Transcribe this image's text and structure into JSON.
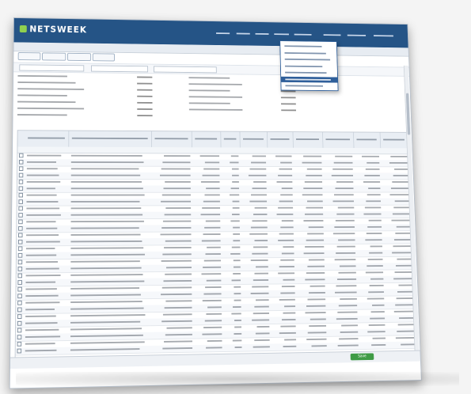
{
  "app": {
    "logo_text": "NETSWEEK",
    "brand_color": "#255486",
    "accent_color": "#3f9b45"
  },
  "nav": {
    "items": [
      {
        "label": ""
      },
      {
        "label": ""
      },
      {
        "label": ""
      },
      {
        "label": ""
      },
      {
        "label": ""
      },
      {
        "label": ""
      },
      {
        "label": ""
      },
      {
        "label": ""
      }
    ]
  },
  "dropdown": {
    "items": [
      {
        "label": ""
      },
      {
        "label": ""
      },
      {
        "label": ""
      },
      {
        "label": ""
      },
      {
        "label": ""
      },
      {
        "label": ""
      },
      {
        "label": ""
      }
    ],
    "highlighted_index": 5
  },
  "subnav": {
    "text": ""
  },
  "toolbar": {
    "buttons": [
      {
        "label": ""
      },
      {
        "label": ""
      },
      {
        "label": ""
      },
      {
        "label": ""
      }
    ]
  },
  "filterbar": {
    "fields": [
      {
        "value": ""
      },
      {
        "value": ""
      },
      {
        "value": ""
      }
    ]
  },
  "summary": {
    "left": [
      {
        "label": "",
        "value": ""
      },
      {
        "label": "",
        "value": ""
      },
      {
        "label": "",
        "value": ""
      },
      {
        "label": "",
        "value": ""
      },
      {
        "label": "",
        "value": ""
      },
      {
        "label": "",
        "value": ""
      },
      {
        "label": "",
        "value": ""
      }
    ],
    "right": [
      {
        "label": "",
        "value": ""
      },
      {
        "label": "",
        "value": ""
      },
      {
        "label": "",
        "value": ""
      },
      {
        "label": "",
        "value": ""
      },
      {
        "label": "",
        "value": ""
      },
      {
        "label": "",
        "value": ""
      }
    ]
  },
  "table": {
    "columns": [
      {
        "label": ""
      },
      {
        "label": ""
      },
      {
        "label": ""
      },
      {
        "label": ""
      },
      {
        "label": ""
      },
      {
        "label": ""
      },
      {
        "label": ""
      },
      {
        "label": ""
      },
      {
        "label": ""
      },
      {
        "label": ""
      },
      {
        "label": ""
      }
    ],
    "group_label": "",
    "rows": [
      {
        "cells": [
          "",
          "",
          "",
          "",
          "",
          "",
          "",
          "",
          "",
          "",
          ""
        ]
      },
      {
        "cells": [
          "",
          "",
          "",
          "",
          "",
          "",
          "",
          "",
          "",
          "",
          ""
        ]
      },
      {
        "cells": [
          "",
          "",
          "",
          "",
          "",
          "",
          "",
          "",
          "",
          "",
          ""
        ]
      },
      {
        "cells": [
          "",
          "",
          "",
          "",
          "",
          "",
          "",
          "",
          "",
          "",
          ""
        ]
      },
      {
        "cells": [
          "",
          "",
          "",
          "",
          "",
          "",
          "",
          "",
          "",
          "",
          ""
        ]
      },
      {
        "cells": [
          "",
          "",
          "",
          "",
          "",
          "",
          "",
          "",
          "",
          "",
          ""
        ]
      },
      {
        "cells": [
          "",
          "",
          "",
          "",
          "",
          "",
          "",
          "",
          "",
          "",
          ""
        ]
      },
      {
        "cells": [
          "",
          "",
          "",
          "",
          "",
          "",
          "",
          "",
          "",
          "",
          ""
        ]
      },
      {
        "cells": [
          "",
          "",
          "",
          "",
          "",
          "",
          "",
          "",
          "",
          "",
          ""
        ]
      },
      {
        "cells": [
          "",
          "",
          "",
          "",
          "",
          "",
          "",
          "",
          "",
          "",
          ""
        ]
      },
      {
        "cells": [
          "",
          "",
          "",
          "",
          "",
          "",
          "",
          "",
          "",
          "",
          ""
        ]
      },
      {
        "cells": [
          "",
          "",
          "",
          "",
          "",
          "",
          "",
          "",
          "",
          "",
          ""
        ]
      },
      {
        "cells": [
          "",
          "",
          "",
          "",
          "",
          "",
          "",
          "",
          "",
          "",
          ""
        ]
      },
      {
        "cells": [
          "",
          "",
          "",
          "",
          "",
          "",
          "",
          "",
          "",
          "",
          ""
        ]
      },
      {
        "cells": [
          "",
          "",
          "",
          "",
          "",
          "",
          "",
          "",
          "",
          "",
          ""
        ]
      },
      {
        "cells": [
          "",
          "",
          "",
          "",
          "",
          "",
          "",
          "",
          "",
          "",
          ""
        ]
      },
      {
        "cells": [
          "",
          "",
          "",
          "",
          "",
          "",
          "",
          "",
          "",
          "",
          ""
        ]
      },
      {
        "cells": [
          "",
          "",
          "",
          "",
          "",
          "",
          "",
          "",
          "",
          "",
          ""
        ]
      },
      {
        "cells": [
          "",
          "",
          "",
          "",
          "",
          "",
          "",
          "",
          "",
          "",
          ""
        ]
      },
      {
        "cells": [
          "",
          "",
          "",
          "",
          "",
          "",
          "",
          "",
          "",
          "",
          ""
        ]
      },
      {
        "cells": [
          "",
          "",
          "",
          "",
          "",
          "",
          "",
          "",
          "",
          "",
          ""
        ]
      },
      {
        "cells": [
          "",
          "",
          "",
          "",
          "",
          "",
          "",
          "",
          "",
          "",
          ""
        ]
      },
      {
        "cells": [
          "",
          "",
          "",
          "",
          "",
          "",
          "",
          "",
          "",
          "",
          ""
        ]
      },
      {
        "cells": [
          "",
          "",
          "",
          "",
          "",
          "",
          "",
          "",
          "",
          "",
          ""
        ]
      },
      {
        "cells": [
          "",
          "",
          "",
          "",
          "",
          "",
          "",
          "",
          "",
          "",
          ""
        ]
      },
      {
        "cells": [
          "",
          "",
          "",
          "",
          "",
          "",
          "",
          "",
          "",
          "",
          ""
        ]
      },
      {
        "cells": [
          "",
          "",
          "",
          "",
          "",
          "",
          "",
          "",
          "",
          "",
          ""
        ]
      },
      {
        "cells": [
          "",
          "",
          "",
          "",
          "",
          "",
          "",
          "",
          "",
          "",
          ""
        ]
      },
      {
        "cells": [
          "",
          "",
          "",
          "",
          "",
          "",
          "",
          "",
          "",
          "",
          ""
        ]
      },
      {
        "cells": [
          "",
          "",
          "",
          "",
          "",
          "",
          "",
          "",
          "",
          "",
          ""
        ]
      }
    ]
  },
  "footer": {
    "save_label": "Save",
    "status_text": ""
  }
}
